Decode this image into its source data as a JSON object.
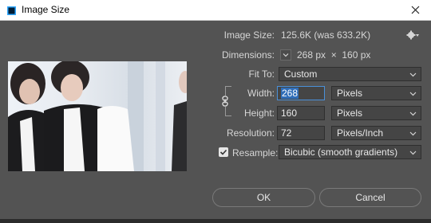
{
  "window": {
    "title": "Image Size",
    "close_icon": "close-icon"
  },
  "info": {
    "image_size_label": "Image Size:",
    "image_size_value": "125.6K (was 633.2K)",
    "dimensions_label": "Dimensions:",
    "dimensions_value": "268 px  ×  160 px"
  },
  "fit_to": {
    "label": "Fit To:",
    "value": "Custom"
  },
  "width": {
    "label": "Width:",
    "value": "268",
    "unit": "Pixels"
  },
  "height": {
    "label": "Height:",
    "value": "160",
    "unit": "Pixels"
  },
  "resolution": {
    "label": "Resolution:",
    "value": "72",
    "unit": "Pixels/Inch"
  },
  "resample": {
    "label": "Resample:",
    "checked": true,
    "value": "Bicubic (smooth gradients)"
  },
  "buttons": {
    "ok": "OK",
    "cancel": "Cancel"
  },
  "colors": {
    "dialog_bg": "#535353",
    "field_bg": "#454545",
    "selection": "#2f6db8"
  }
}
